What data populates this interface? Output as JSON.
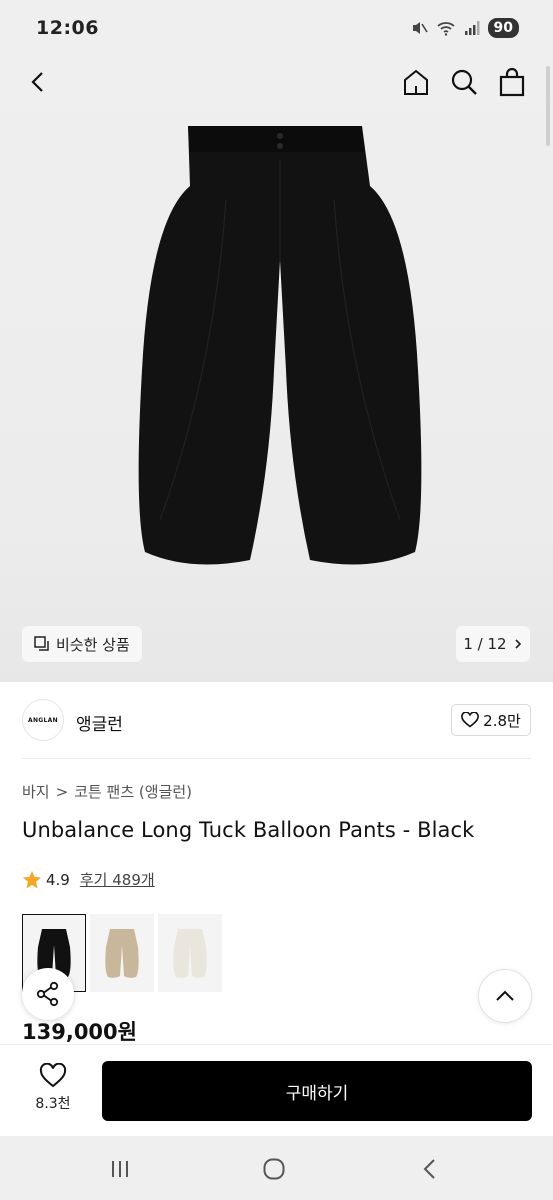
{
  "status_bar": {
    "time": "12:06",
    "battery": "90"
  },
  "gallery": {
    "similar_label": "비슷한 상품",
    "page_indicator": "1 / 12"
  },
  "brand": {
    "logo_text": "ANGLAN",
    "name": "앵글런",
    "likes": "2.8만"
  },
  "breadcrumb": {
    "category": "바지",
    "separator": ">",
    "subcategory": "코튼 팬츠 (앵글런)"
  },
  "product": {
    "title": "Unbalance Long Tuck Balloon Pants - Black",
    "rating": "4.9",
    "reviews": "후기 489개",
    "price": "139,000원",
    "swatches": [
      {
        "color": "#111111"
      },
      {
        "color": "#c8b79a"
      },
      {
        "color": "#eae6dd"
      }
    ]
  },
  "purchase_bar": {
    "like_count": "8.3천",
    "buy_label": "구매하기"
  },
  "colors": {
    "accent_star": "#f5a623",
    "buy_button": "#000000"
  },
  "icons": [
    "back-icon",
    "home-icon",
    "search-icon",
    "shopping-bag-icon",
    "similar-icon",
    "chevron-right-icon",
    "heart-icon",
    "star-icon",
    "share-icon",
    "chevron-up-icon",
    "recent-apps-icon",
    "home-circle-icon",
    "back-nav-icon"
  ]
}
